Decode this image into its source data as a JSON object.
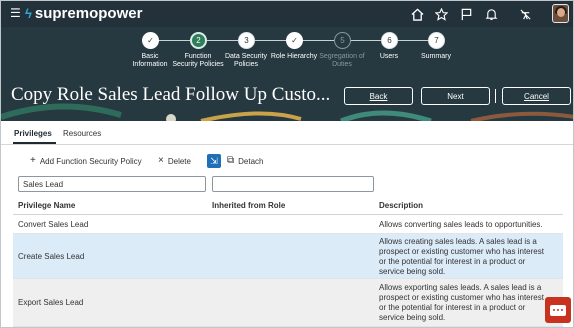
{
  "app": {
    "brand": "supremopower",
    "menu_icon": "hamburger-icon",
    "header_icons": [
      "home-icon",
      "star-icon",
      "flag-icon",
      "bell-icon",
      "accessibility-icon"
    ]
  },
  "train": {
    "steps": [
      {
        "marker": "✓",
        "label": "Basic\nInformation",
        "state": "done"
      },
      {
        "marker": "2",
        "label": "Function\nSecurity Policies",
        "state": "current"
      },
      {
        "marker": "3",
        "label": "Data Security\nPolicies",
        "state": "todo"
      },
      {
        "marker": "✓",
        "label": "Role Hierarchy",
        "state": "done"
      },
      {
        "marker": "5",
        "label": "Segregation of\nDuties",
        "state": "disabled"
      },
      {
        "marker": "6",
        "label": "Users",
        "state": "todo"
      },
      {
        "marker": "7",
        "label": "Summary",
        "state": "todo"
      }
    ]
  },
  "page": {
    "title": "Copy Role Sales Lead Follow Up Custo..."
  },
  "actions": {
    "back": "Back",
    "next": "Next",
    "cancel": "Cancel"
  },
  "tabs": [
    {
      "label": "Privileges",
      "active": true
    },
    {
      "label": "Resources",
      "active": false
    }
  ],
  "toolbar": {
    "add": "Add Function Security Policy",
    "delete": "Delete",
    "detach": "Detach"
  },
  "filters": {
    "privilege": "Sales Lead",
    "inherited": ""
  },
  "table": {
    "headers": [
      "Privilege Name",
      "Inherited from Role",
      "Description"
    ],
    "rows": [
      {
        "name": "Convert Sales Lead",
        "inherited": "",
        "description": "Allows converting sales leads to opportunities."
      },
      {
        "name": "Create Sales Lead",
        "inherited": "",
        "description": "Allows creating sales leads. A sales lead is a prospect or existing customer who has interest or the potential for interest in a product or service being sold."
      },
      {
        "name": "Export Sales Lead",
        "inherited": "",
        "description": "Allows exporting sales leads. A sales lead is a prospect or existing customer who has interest or the potential for interest in a product or service being sold."
      }
    ]
  },
  "colors": {
    "header_bg": "#22313a",
    "band_bg": "#263840",
    "current_step": "#2e7d5b",
    "selected_row": "#dcebf8",
    "chat": "#c8321f"
  }
}
